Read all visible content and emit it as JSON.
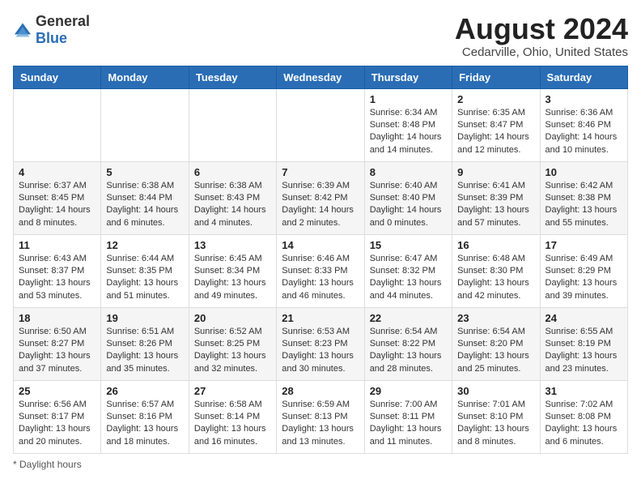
{
  "header": {
    "logo_general": "General",
    "logo_blue": "Blue",
    "month_year": "August 2024",
    "location": "Cedarville, Ohio, United States"
  },
  "calendar": {
    "days_of_week": [
      "Sunday",
      "Monday",
      "Tuesday",
      "Wednesday",
      "Thursday",
      "Friday",
      "Saturday"
    ],
    "weeks": [
      [
        {
          "day": "",
          "content": ""
        },
        {
          "day": "",
          "content": ""
        },
        {
          "day": "",
          "content": ""
        },
        {
          "day": "",
          "content": ""
        },
        {
          "day": "1",
          "content": "Sunrise: 6:34 AM\nSunset: 8:48 PM\nDaylight: 14 hours and 14 minutes."
        },
        {
          "day": "2",
          "content": "Sunrise: 6:35 AM\nSunset: 8:47 PM\nDaylight: 14 hours and 12 minutes."
        },
        {
          "day": "3",
          "content": "Sunrise: 6:36 AM\nSunset: 8:46 PM\nDaylight: 14 hours and 10 minutes."
        }
      ],
      [
        {
          "day": "4",
          "content": "Sunrise: 6:37 AM\nSunset: 8:45 PM\nDaylight: 14 hours and 8 minutes."
        },
        {
          "day": "5",
          "content": "Sunrise: 6:38 AM\nSunset: 8:44 PM\nDaylight: 14 hours and 6 minutes."
        },
        {
          "day": "6",
          "content": "Sunrise: 6:38 AM\nSunset: 8:43 PM\nDaylight: 14 hours and 4 minutes."
        },
        {
          "day": "7",
          "content": "Sunrise: 6:39 AM\nSunset: 8:42 PM\nDaylight: 14 hours and 2 minutes."
        },
        {
          "day": "8",
          "content": "Sunrise: 6:40 AM\nSunset: 8:40 PM\nDaylight: 14 hours and 0 minutes."
        },
        {
          "day": "9",
          "content": "Sunrise: 6:41 AM\nSunset: 8:39 PM\nDaylight: 13 hours and 57 minutes."
        },
        {
          "day": "10",
          "content": "Sunrise: 6:42 AM\nSunset: 8:38 PM\nDaylight: 13 hours and 55 minutes."
        }
      ],
      [
        {
          "day": "11",
          "content": "Sunrise: 6:43 AM\nSunset: 8:37 PM\nDaylight: 13 hours and 53 minutes."
        },
        {
          "day": "12",
          "content": "Sunrise: 6:44 AM\nSunset: 8:35 PM\nDaylight: 13 hours and 51 minutes."
        },
        {
          "day": "13",
          "content": "Sunrise: 6:45 AM\nSunset: 8:34 PM\nDaylight: 13 hours and 49 minutes."
        },
        {
          "day": "14",
          "content": "Sunrise: 6:46 AM\nSunset: 8:33 PM\nDaylight: 13 hours and 46 minutes."
        },
        {
          "day": "15",
          "content": "Sunrise: 6:47 AM\nSunset: 8:32 PM\nDaylight: 13 hours and 44 minutes."
        },
        {
          "day": "16",
          "content": "Sunrise: 6:48 AM\nSunset: 8:30 PM\nDaylight: 13 hours and 42 minutes."
        },
        {
          "day": "17",
          "content": "Sunrise: 6:49 AM\nSunset: 8:29 PM\nDaylight: 13 hours and 39 minutes."
        }
      ],
      [
        {
          "day": "18",
          "content": "Sunrise: 6:50 AM\nSunset: 8:27 PM\nDaylight: 13 hours and 37 minutes."
        },
        {
          "day": "19",
          "content": "Sunrise: 6:51 AM\nSunset: 8:26 PM\nDaylight: 13 hours and 35 minutes."
        },
        {
          "day": "20",
          "content": "Sunrise: 6:52 AM\nSunset: 8:25 PM\nDaylight: 13 hours and 32 minutes."
        },
        {
          "day": "21",
          "content": "Sunrise: 6:53 AM\nSunset: 8:23 PM\nDaylight: 13 hours and 30 minutes."
        },
        {
          "day": "22",
          "content": "Sunrise: 6:54 AM\nSunset: 8:22 PM\nDaylight: 13 hours and 28 minutes."
        },
        {
          "day": "23",
          "content": "Sunrise: 6:54 AM\nSunset: 8:20 PM\nDaylight: 13 hours and 25 minutes."
        },
        {
          "day": "24",
          "content": "Sunrise: 6:55 AM\nSunset: 8:19 PM\nDaylight: 13 hours and 23 minutes."
        }
      ],
      [
        {
          "day": "25",
          "content": "Sunrise: 6:56 AM\nSunset: 8:17 PM\nDaylight: 13 hours and 20 minutes."
        },
        {
          "day": "26",
          "content": "Sunrise: 6:57 AM\nSunset: 8:16 PM\nDaylight: 13 hours and 18 minutes."
        },
        {
          "day": "27",
          "content": "Sunrise: 6:58 AM\nSunset: 8:14 PM\nDaylight: 13 hours and 16 minutes."
        },
        {
          "day": "28",
          "content": "Sunrise: 6:59 AM\nSunset: 8:13 PM\nDaylight: 13 hours and 13 minutes."
        },
        {
          "day": "29",
          "content": "Sunrise: 7:00 AM\nSunset: 8:11 PM\nDaylight: 13 hours and 11 minutes."
        },
        {
          "day": "30",
          "content": "Sunrise: 7:01 AM\nSunset: 8:10 PM\nDaylight: 13 hours and 8 minutes."
        },
        {
          "day": "31",
          "content": "Sunrise: 7:02 AM\nSunset: 8:08 PM\nDaylight: 13 hours and 6 minutes."
        }
      ]
    ]
  },
  "footer": {
    "note": "* Daylight hours"
  }
}
